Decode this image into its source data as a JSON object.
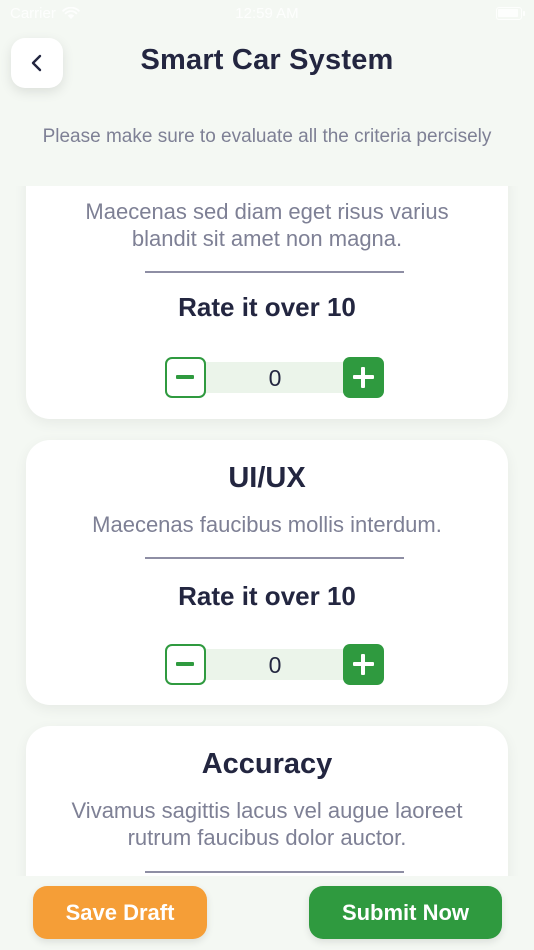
{
  "status_bar": {
    "carrier": "Carrier",
    "time": "12:59 AM"
  },
  "header": {
    "title": "Smart Car System",
    "subtitle": "Please make sure to evaluate all the criteria percisely"
  },
  "criteria": [
    {
      "title": "",
      "description": "Maecenas sed diam eget risus varius blandit sit amet non magna.",
      "rate_label": "Rate it over 10",
      "value": "0"
    },
    {
      "title": "UI/UX",
      "description": "Maecenas faucibus mollis interdum.",
      "rate_label": "Rate it over 10",
      "value": "0"
    },
    {
      "title": "Accuracy",
      "description": "Vivamus sagittis lacus vel augue laoreet rutrum faucibus dolor auctor.",
      "rate_label": "",
      "value": ""
    }
  ],
  "footer": {
    "save_draft_label": "Save Draft",
    "submit_label": "Submit Now"
  },
  "colors": {
    "background": "#f4f8f3",
    "primary_green": "#2f9a3f",
    "draft_orange": "#f59e37",
    "text_dark": "#232640",
    "text_muted": "#7e8095"
  },
  "icons": {
    "back": "chevron-left-icon",
    "wifi": "wifi-icon",
    "battery": "battery-icon",
    "minus": "minus-icon",
    "plus": "plus-icon"
  }
}
